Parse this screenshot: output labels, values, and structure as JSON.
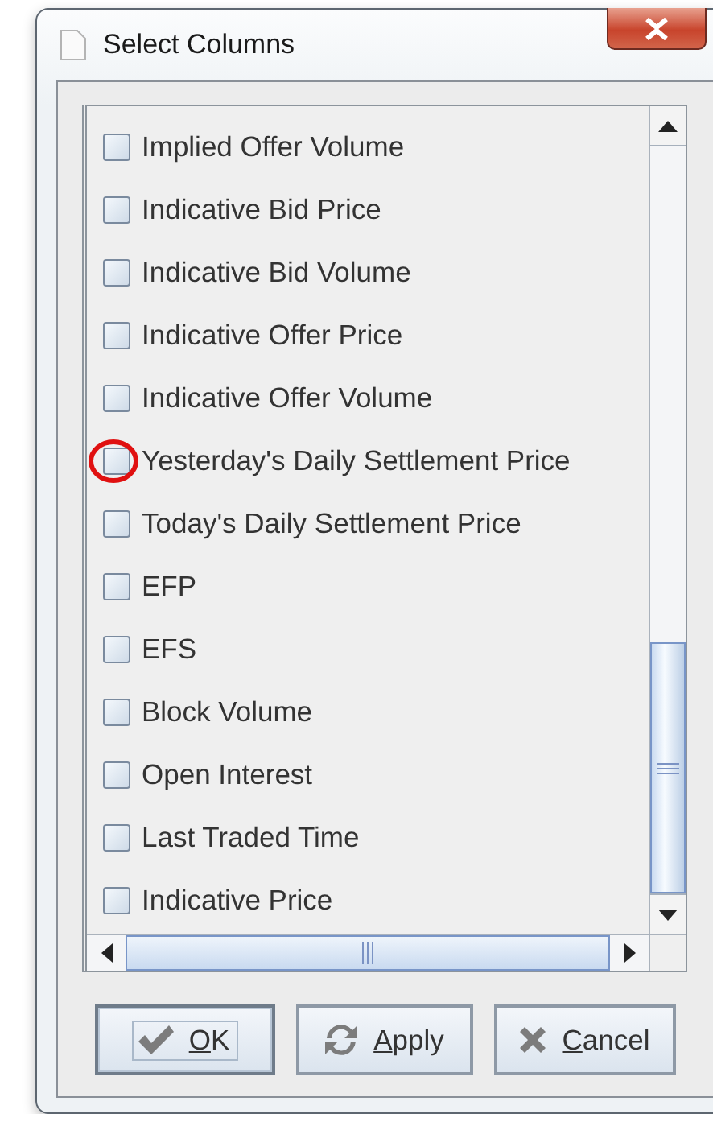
{
  "window": {
    "title": "Select Columns"
  },
  "columns": [
    {
      "label": "Implied Offer Volume",
      "checked": false,
      "highlighted": false
    },
    {
      "label": "Indicative Bid Price",
      "checked": false,
      "highlighted": false
    },
    {
      "label": "Indicative Bid Volume",
      "checked": false,
      "highlighted": false
    },
    {
      "label": "Indicative Offer Price",
      "checked": false,
      "highlighted": false
    },
    {
      "label": "Indicative Offer Volume",
      "checked": false,
      "highlighted": false
    },
    {
      "label": "Yesterday's Daily Settlement Price",
      "checked": false,
      "highlighted": true
    },
    {
      "label": "Today's Daily Settlement Price",
      "checked": false,
      "highlighted": false
    },
    {
      "label": "EFP",
      "checked": false,
      "highlighted": false
    },
    {
      "label": "EFS",
      "checked": false,
      "highlighted": false
    },
    {
      "label": "Block Volume",
      "checked": false,
      "highlighted": false
    },
    {
      "label": "Open Interest",
      "checked": false,
      "highlighted": false
    },
    {
      "label": "Last Traded Time",
      "checked": false,
      "highlighted": false
    },
    {
      "label": "Indicative Price",
      "checked": false,
      "highlighted": false
    }
  ],
  "buttons": [
    {
      "label": "OK",
      "kind": "ok",
      "focused": true
    },
    {
      "label": "Apply",
      "kind": "apply",
      "focused": false
    },
    {
      "label": "Cancel",
      "kind": "cancel",
      "focused": false
    }
  ]
}
